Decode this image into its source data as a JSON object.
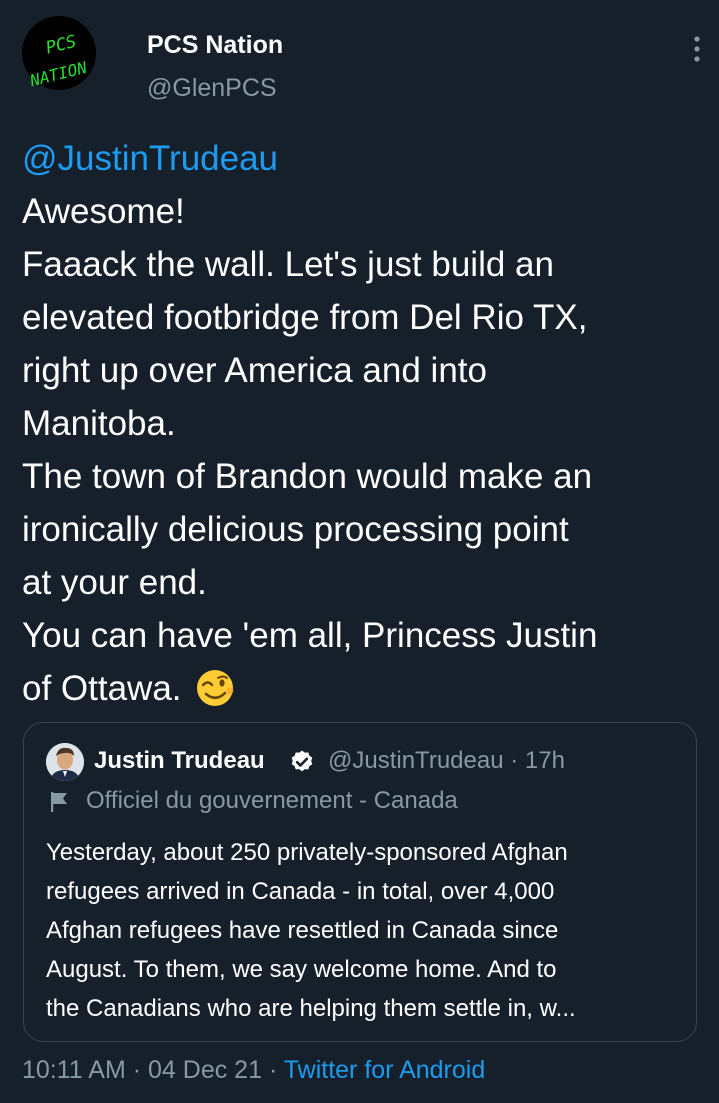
{
  "author": {
    "avatar_text": [
      "PCS",
      "NATION"
    ],
    "display_name": "PCS Nation",
    "handle": "@GlenPCS"
  },
  "tweet": {
    "mention": "@JustinTrudeau",
    "lines": [
      "Awesome!",
      "Faaack the wall. Let's just build an",
      "elevated footbridge from Del Rio TX,",
      "right up over America and into",
      "Manitoba.",
      "The town of Brandon would make an",
      "ironically delicious processing point",
      "at your end.",
      "You can have 'em all, Princess Justin",
      "of Ottawa."
    ],
    "emoji": "winking-face"
  },
  "quoted_tweet": {
    "display_name": "Justin Trudeau",
    "handle": "@JustinTrudeau",
    "separator": "·",
    "time": "17h",
    "label": "Officiel du gouvernement - Canada",
    "lines": [
      "Yesterday, about 250 privately-sponsored Afghan",
      "refugees arrived in Canada - in total, over 4,000",
      "Afghan refugees have resettled in Canada since",
      "August. To them, we say welcome home. And to",
      "the Canadians who are helping them settle in, w..."
    ]
  },
  "meta": {
    "time": "10:11 AM",
    "separator": "·",
    "date": "04 Dec 21",
    "source": "Twitter for Android"
  },
  "colors": {
    "background": "#15202b",
    "accent": "#1d9bf0",
    "secondary_text": "#8899a6",
    "border": "#38444d",
    "avatar_text": "#27e02c"
  }
}
